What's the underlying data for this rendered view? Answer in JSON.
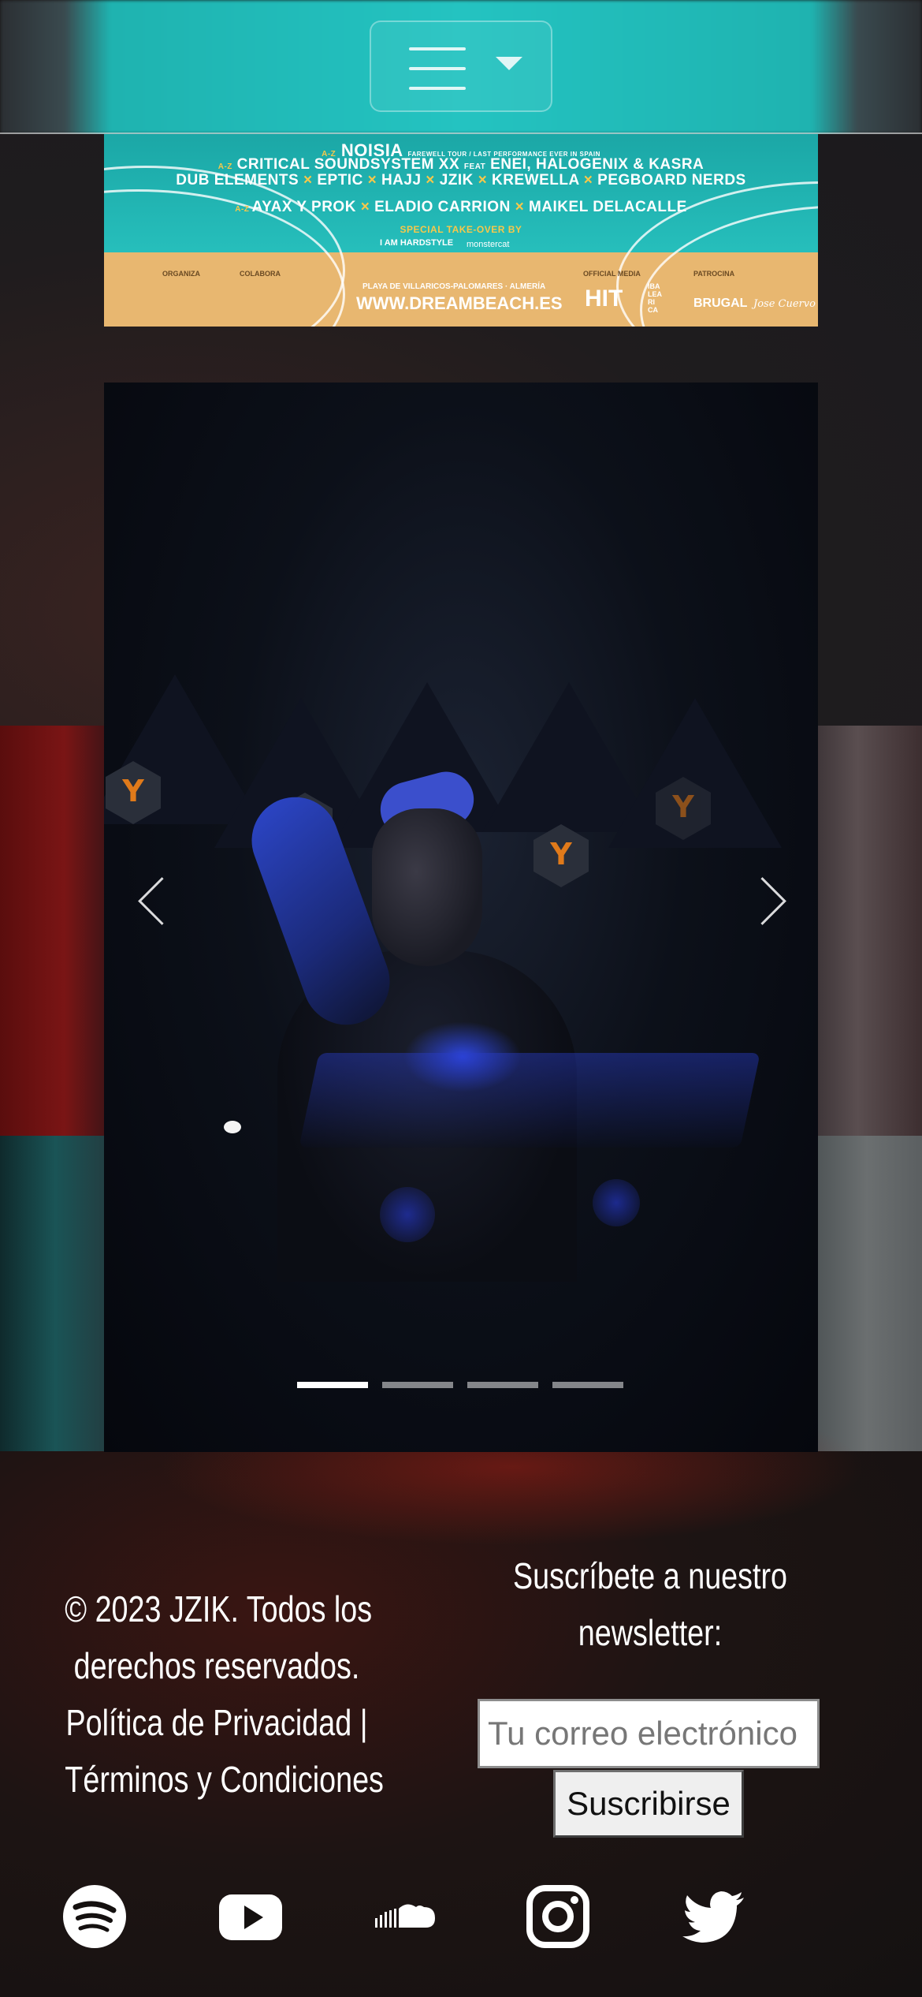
{
  "header": {
    "menu_icon": "hamburger-menu-icon",
    "dropdown_icon": "caret-down-icon"
  },
  "banner": {
    "lineup": {
      "line1_prefix": "A-Z",
      "line1_name": "NOISIA",
      "line1_note": "FAREWELL TOUR / LAST PERFORMANCE EVER IN SPAIN",
      "line2_prefix": "A-Z",
      "line2": "CRITICAL SOUNDSYSTEM XX",
      "line2_feat": "FEAT",
      "line2_rest": "ENEI, HALOGENIX & KASRA",
      "line3": [
        "DUB ELEMENTS",
        "EPTIC",
        "HAJJ",
        "JZIK",
        "KREWELLA",
        "PEGBOARD NERDS"
      ],
      "line4_prefix": "A-Z",
      "line4": [
        "AYAX Y PROK",
        "ELADIO CARRION",
        "MAIKEL DELACALLE"
      ],
      "separator": "×"
    },
    "special_takeover": "SPECIAL TAKE-OVER BY",
    "takeover_brands": [
      "I AM HARDSTYLE",
      "monstercat"
    ],
    "organiza": "ORGANIZA",
    "colabora": "COLABORA",
    "official_media": "OFFICIAL MEDIA",
    "patrocina": "PATROCINA",
    "location": "PLAYA DE VILLARICOS-PALOMARES · ALMERÍA",
    "url": "WWW.DREAMBEACH.ES",
    "media_logo": "HIT",
    "media_sub": [
      "IBA",
      "LEA",
      "RI",
      "CA"
    ],
    "sponsors": [
      "BRUGAL",
      "Jose Cuervo"
    ]
  },
  "carousel": {
    "slide_count": 4,
    "active_index": 0,
    "prev_icon": "chevron-left-icon",
    "next_icon": "chevron-right-icon"
  },
  "footer": {
    "copyright_line1": "© 2023 JZIK. Todos los",
    "copyright_line2": "derechos reservados.",
    "privacy_link": "Política de Privacidad",
    "divider": "|",
    "terms_link": "Términos y Condiciones",
    "newsletter_line1": "Suscríbete a nuestro",
    "newsletter_line2": "newsletter:",
    "email_placeholder": "Tu correo electrónico",
    "subscribe_label": "Suscribirse",
    "social": [
      "spotify-icon",
      "youtube-icon",
      "soundcloud-icon",
      "instagram-icon",
      "twitter-icon"
    ]
  }
}
